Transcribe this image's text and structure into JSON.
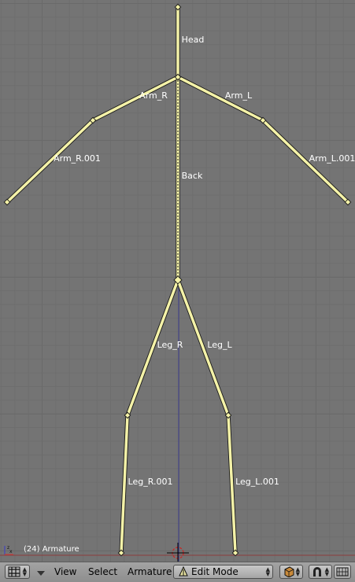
{
  "viewport": {
    "status_text": "(24) Armature",
    "bones": [
      {
        "name": "Head",
        "label": "Head"
      },
      {
        "name": "Back",
        "label": "Back"
      },
      {
        "name": "Arm_R",
        "label": "Arm_R"
      },
      {
        "name": "Arm_L",
        "label": "Arm_L"
      },
      {
        "name": "Arm_R.001",
        "label": "Arm_R.001"
      },
      {
        "name": "Arm_L.001",
        "label": "Arm_L.001"
      },
      {
        "name": "Leg_R",
        "label": "Leg_R"
      },
      {
        "name": "Leg_L",
        "label": "Leg_L"
      },
      {
        "name": "Leg_R.001",
        "label": "Leg_R.001"
      },
      {
        "name": "Leg_L.001",
        "label": "Leg_L.001"
      }
    ],
    "colors": {
      "bone": "#f4f2a8",
      "bone_outline": "#1a1a1a",
      "axis_line": "#3c3c8c",
      "cursor": "#cc2222"
    }
  },
  "header": {
    "editor_type_icon": "grid-icon",
    "menus": [
      {
        "label": "View"
      },
      {
        "label": "Select"
      },
      {
        "label": "Armature"
      }
    ],
    "mode": {
      "label": "Edit Mode",
      "icon": "armature-icon"
    },
    "shading_icon": "solid-shading-icon",
    "snap_icon": "magnet-icon",
    "layers_icon": "layers-icon"
  }
}
